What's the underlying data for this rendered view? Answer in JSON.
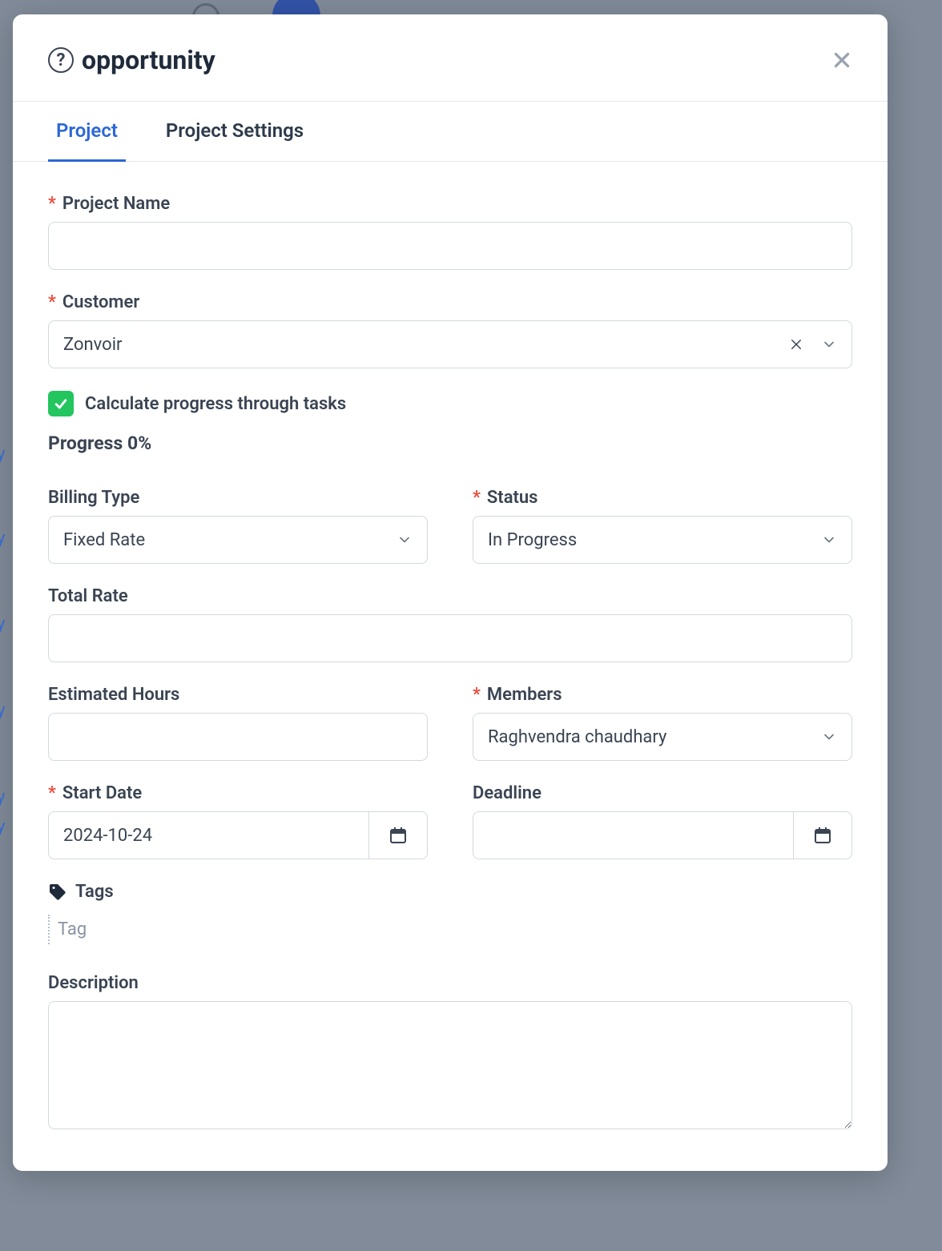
{
  "modal": {
    "title": "opportunity",
    "tabs": [
      {
        "label": "Project",
        "active": true
      },
      {
        "label": "Project Settings",
        "active": false
      }
    ]
  },
  "fields": {
    "projectName": {
      "label": "Project Name",
      "value": ""
    },
    "customer": {
      "label": "Customer",
      "value": "Zonvoir"
    },
    "calcProgress": {
      "label": "Calculate progress through tasks",
      "checked": true
    },
    "progress": {
      "label": "Progress 0%"
    },
    "billingType": {
      "label": "Billing Type",
      "value": "Fixed Rate"
    },
    "status": {
      "label": "Status",
      "value": "In Progress"
    },
    "totalRate": {
      "label": "Total Rate",
      "value": ""
    },
    "estimatedHours": {
      "label": "Estimated Hours",
      "value": ""
    },
    "members": {
      "label": "Members",
      "value": "Raghvendra chaudhary"
    },
    "startDate": {
      "label": "Start Date",
      "value": "2024-10-24"
    },
    "deadline": {
      "label": "Deadline",
      "value": ""
    },
    "tags": {
      "label": "Tags",
      "placeholder": "Tag"
    },
    "description": {
      "label": "Description",
      "value": ""
    }
  }
}
